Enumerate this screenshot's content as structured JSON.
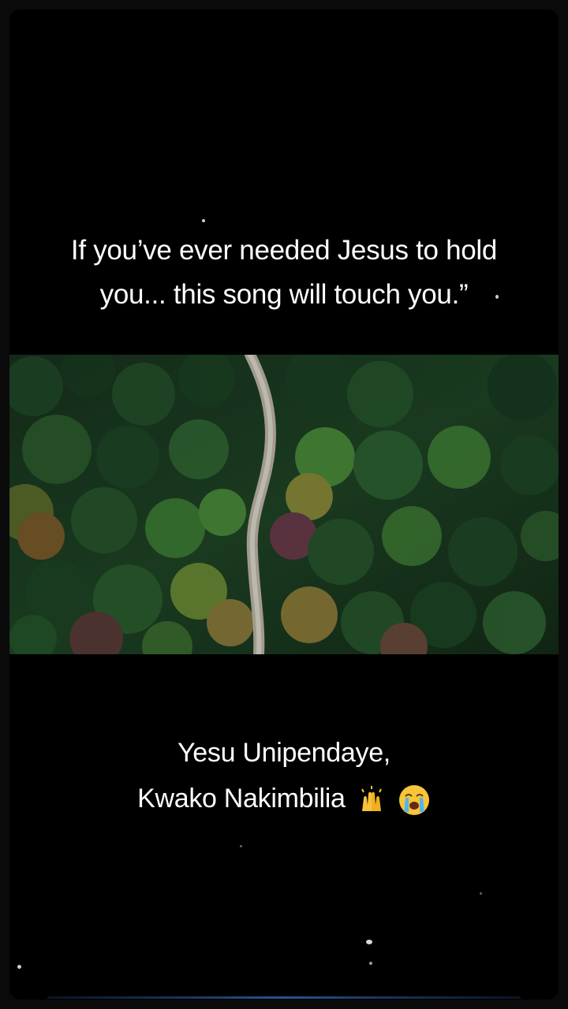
{
  "captions": {
    "top_line1": "If you’ve ever needed Jesus to hold",
    "top_line2": "you... this song will touch you.”",
    "bottom_line1": "Yesu Unipendaye,",
    "bottom_line2": "Kwako Nakimbilia"
  },
  "icons": {
    "emoji1": "raising-hands-emoji",
    "emoji2": "crying-face-emoji"
  },
  "colors": {
    "background": "#000000",
    "text": "#ffffff",
    "forest_dark": "#0f2a18",
    "forest_mid": "#2d5a2f",
    "road": "#c9c2b5"
  }
}
